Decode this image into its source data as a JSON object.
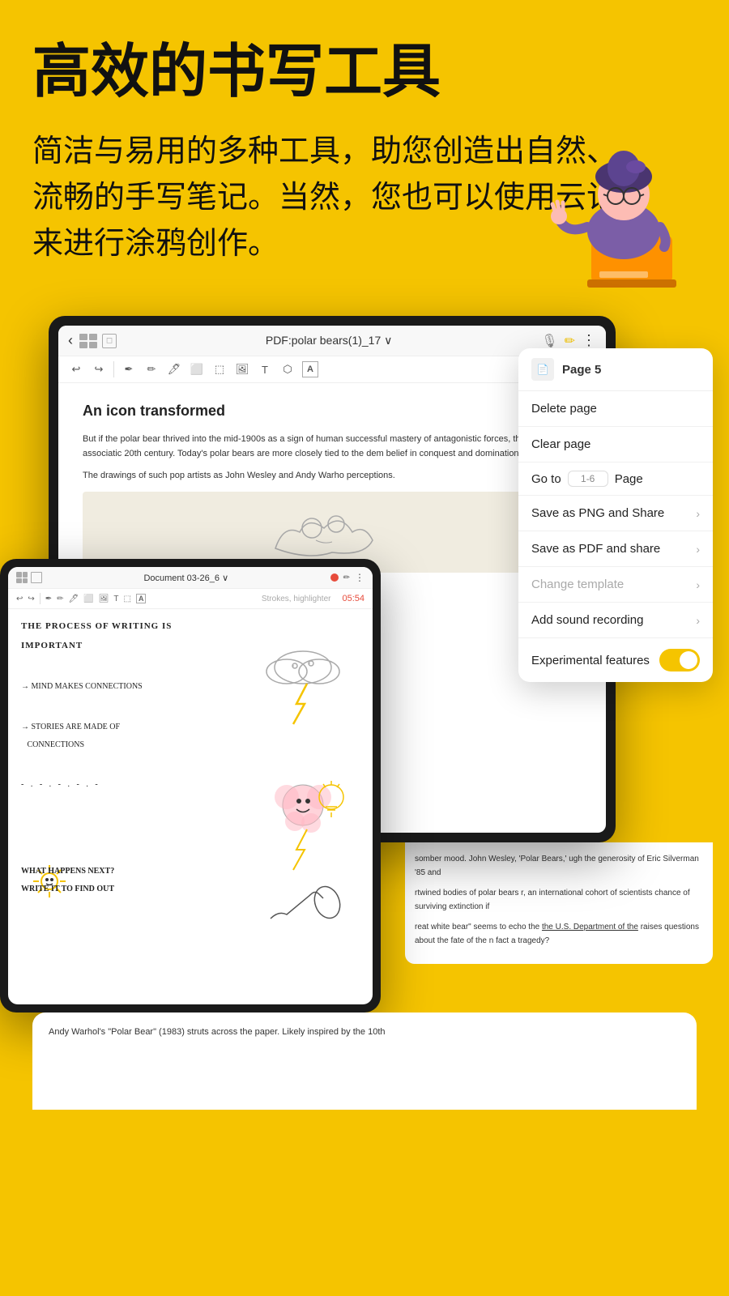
{
  "hero": {
    "title": "高效的书写工具",
    "description": "简洁与易用的多种工具，助您创造出自然、流畅的手写笔记。当然，您也可以使用云记来进行涂鸦创作。"
  },
  "tablet_main": {
    "topbar": {
      "title": "PDF:polar bears(1)_17 ∨"
    },
    "content": {
      "heading": "An icon transformed",
      "paragraph1": "But if the polar bear thrived into the mid-1900s as a sign of human successful mastery of antagonistic forces, this symbolic associatic 20th century. Today's polar bears are more closely tied to the dem belief in conquest and domination.",
      "paragraph2": "The drawings of such pop artists as John Wesley and Andy Warho perceptions."
    }
  },
  "dropdown": {
    "header_title": "Page 5",
    "items": [
      {
        "label": "Delete page",
        "arrow": true,
        "disabled": false
      },
      {
        "label": "Clear page",
        "arrow": false,
        "disabled": false
      },
      {
        "label": "Go to",
        "type": "goto",
        "placeholder": "1-6",
        "page_label": "Page"
      },
      {
        "label": "Save as PNG and Share",
        "arrow": true,
        "disabled": false
      },
      {
        "label": "Save as PDF and share",
        "arrow": true,
        "disabled": false
      },
      {
        "label": "Change template",
        "arrow": true,
        "disabled": true
      },
      {
        "label": "Add sound recording",
        "arrow": true,
        "disabled": false
      },
      {
        "label": "Experimental features",
        "type": "toggle",
        "enabled": true
      }
    ]
  },
  "tablet_small": {
    "topbar": {
      "title": "Document 03-26_6 ∨"
    },
    "strokes_label": "Strokes, highlighter",
    "timer": "05:54",
    "handwriting": [
      "THE PROCESS OF WRITING IS",
      "IMPORTANT",
      "",
      "→ MIND MAKES CONNECTIONS",
      "",
      "→ STORIES ARE MADE OF",
      "   CONNECTIONS",
      "",
      "- . - . - . - . - .",
      "",
      "",
      "",
      "WHAT HAPPENS NEXT?",
      "WRITE IT TO FIND OUT"
    ]
  },
  "bottom_doc": {
    "text1": "somber mood. John Wesley, 'Polar Bears,' ugh the generosity of Eric Silverman '85 and",
    "text2": "rtwined bodies of polar bears r, an international cohort of scientists chance of surviving extinction if",
    "text3": "reat white bear\" seems to echo the the U.S. Department of the raises questions about the fate of the n fact a tragedy?",
    "text4": "Department of the",
    "footer_text": "Andy Warhol's \"Polar Bear\" (1983) struts across the paper. Likely inspired by the 10th"
  }
}
